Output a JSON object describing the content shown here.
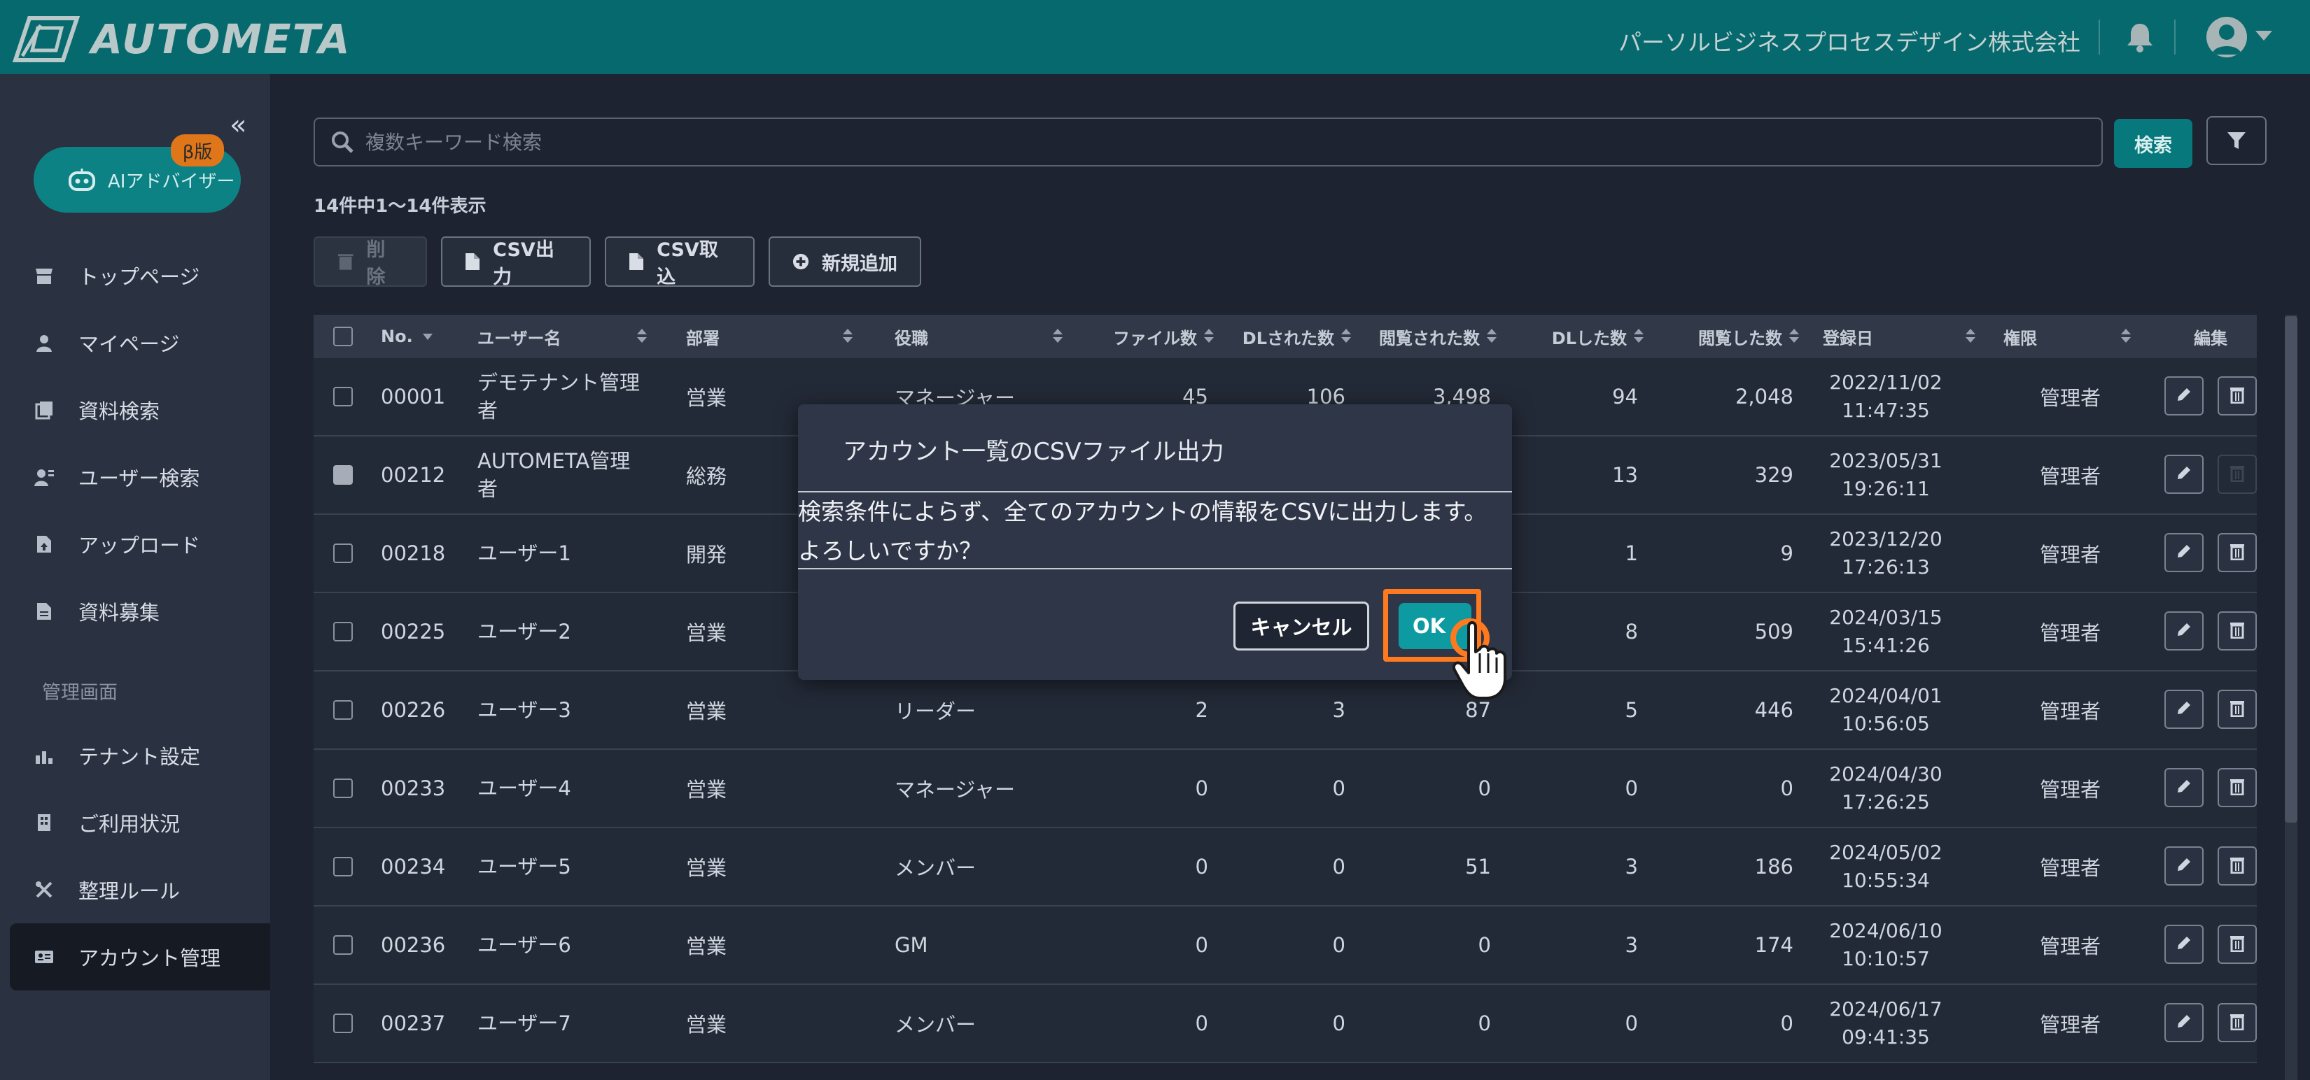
{
  "header": {
    "logo_text": "AUTOMETA",
    "company": "パーソルビジネスプロセスデザイン株式会社"
  },
  "sidebar": {
    "ai_advisor": {
      "label": "AIアドバイザー",
      "badge": "β版"
    },
    "items": [
      {
        "label": "トップページ",
        "icon": "store-icon"
      },
      {
        "label": "マイページ",
        "icon": "person-icon"
      },
      {
        "label": "資料検索",
        "icon": "documents-icon"
      },
      {
        "label": "ユーザー検索",
        "icon": "user-search-icon"
      },
      {
        "label": "アップロード",
        "icon": "file-upload-icon"
      },
      {
        "label": "資料募集",
        "icon": "file-icon"
      }
    ],
    "admin_section": "管理画面",
    "admin_items": [
      {
        "label": "テナント設定",
        "icon": "chart-icon"
      },
      {
        "label": "ご利用状況",
        "icon": "building-icon"
      },
      {
        "label": "整理ルール",
        "icon": "tools-icon"
      },
      {
        "label": "アカウント管理",
        "icon": "id-card-icon",
        "active": true
      }
    ]
  },
  "search": {
    "placeholder": "複数キーワード検索",
    "button": "検索"
  },
  "result_count": "14件中1〜14件表示",
  "toolbar": {
    "delete": "削除",
    "csv_export": "CSV出力",
    "csv_import": "CSV取込",
    "add_new": "新規追加"
  },
  "table": {
    "headers": [
      "No.",
      "ユーザー名",
      "部署",
      "役職",
      "ファイル数",
      "DLされた数",
      "閲覧された数",
      "DLした数",
      "閲覧した数",
      "登録日",
      "権限",
      "編集"
    ],
    "rows": [
      {
        "no": "00001",
        "name": "デモテナント管理\n者",
        "dept": "営業",
        "role": "マネージャー",
        "files": "45",
        "dl_by": "106",
        "viewed_by": "3,498",
        "dl": "94",
        "viewed": "2,048",
        "date": "2022/11/02",
        "time": "11:47:35",
        "perm": "管理者",
        "checked": false,
        "delete_enabled": true
      },
      {
        "no": "00212",
        "name": "AUTOMETA管理者",
        "dept": "総務",
        "role": "",
        "files": "",
        "dl_by": "",
        "viewed_by": "",
        "dl": "13",
        "viewed": "329",
        "date": "2023/05/31",
        "time": "19:26:11",
        "perm": "管理者",
        "checked": true,
        "delete_enabled": false
      },
      {
        "no": "00218",
        "name": "ユーザー1",
        "dept": "開発",
        "role": "",
        "files": "",
        "dl_by": "",
        "viewed_by": "",
        "dl": "1",
        "viewed": "9",
        "date": "2023/12/20",
        "time": "17:26:13",
        "perm": "管理者",
        "checked": false,
        "delete_enabled": true
      },
      {
        "no": "00225",
        "name": "ユーザー2",
        "dept": "営業",
        "role": "",
        "files": "",
        "dl_by": "",
        "viewed_by": "",
        "dl": "8",
        "viewed": "509",
        "date": "2024/03/15",
        "time": "15:41:26",
        "perm": "管理者",
        "checked": false,
        "delete_enabled": true
      },
      {
        "no": "00226",
        "name": "ユーザー3",
        "dept": "営業",
        "role": "リーダー",
        "files": "2",
        "dl_by": "3",
        "viewed_by": "87",
        "dl": "5",
        "viewed": "446",
        "date": "2024/04/01",
        "time": "10:56:05",
        "perm": "管理者",
        "checked": false,
        "delete_enabled": true
      },
      {
        "no": "00233",
        "name": "ユーザー4",
        "dept": "営業",
        "role": "マネージャー",
        "files": "0",
        "dl_by": "0",
        "viewed_by": "0",
        "dl": "0",
        "viewed": "0",
        "date": "2024/04/30",
        "time": "17:26:25",
        "perm": "管理者",
        "checked": false,
        "delete_enabled": true
      },
      {
        "no": "00234",
        "name": "ユーザー5",
        "dept": "営業",
        "role": "メンバー",
        "files": "0",
        "dl_by": "0",
        "viewed_by": "51",
        "dl": "3",
        "viewed": "186",
        "date": "2024/05/02",
        "time": "10:55:34",
        "perm": "管理者",
        "checked": false,
        "delete_enabled": true
      },
      {
        "no": "00236",
        "name": "ユーザー6",
        "dept": "営業",
        "role": "GM",
        "files": "0",
        "dl_by": "0",
        "viewed_by": "0",
        "dl": "3",
        "viewed": "174",
        "date": "2024/06/10",
        "time": "10:10:57",
        "perm": "管理者",
        "checked": false,
        "delete_enabled": true
      },
      {
        "no": "00237",
        "name": "ユーザー7",
        "dept": "営業",
        "role": "メンバー",
        "files": "0",
        "dl_by": "0",
        "viewed_by": "0",
        "dl": "0",
        "viewed": "0",
        "date": "2024/06/17",
        "time": "09:41:35",
        "perm": "管理者",
        "checked": false,
        "delete_enabled": true
      }
    ]
  },
  "modal": {
    "title": "アカウント一覧のCSVファイル出力",
    "body_line1": "検索条件によらず、全てのアカウントの情報をCSVに出力します。",
    "body_line2": "よろしいですか？",
    "cancel": "キャンセル",
    "ok": "OK"
  },
  "colors": {
    "header_bg": "#06696d",
    "accent": "#0d9aa0",
    "highlight": "#ff7a1e",
    "beta_badge": "#e0761a"
  }
}
